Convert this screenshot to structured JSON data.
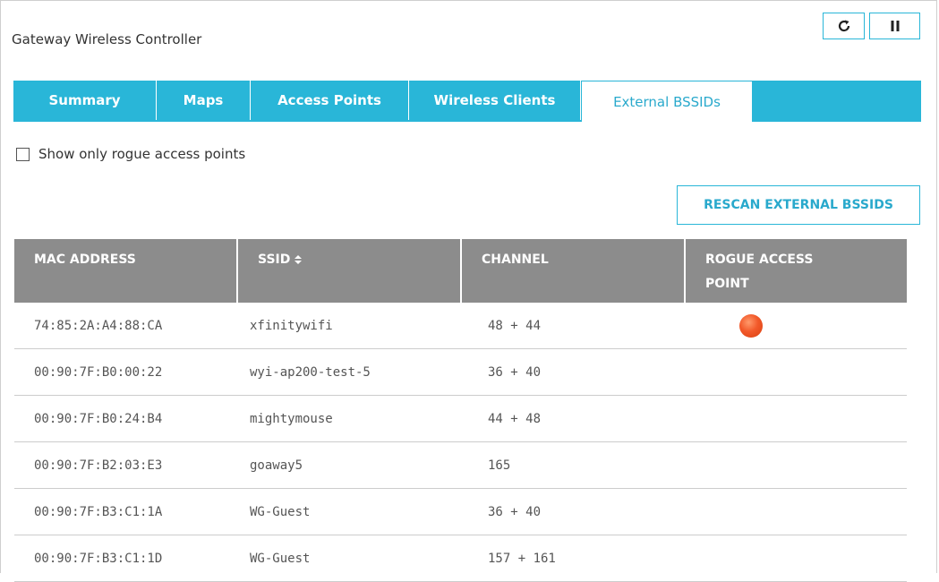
{
  "window": {
    "title": "Gateway Wireless Controller",
    "controls": [
      {
        "icon": "refresh-icon"
      },
      {
        "icon": "pause-icon"
      }
    ]
  },
  "tabs": [
    {
      "label": "Summary",
      "active": false
    },
    {
      "label": "Maps",
      "active": false
    },
    {
      "label": "Access Points",
      "active": false
    },
    {
      "label": "Wireless Clients",
      "active": false
    },
    {
      "label": "External BSSIDs",
      "active": true
    }
  ],
  "filter": {
    "label": "Show only rogue access points",
    "checked": false
  },
  "actions": {
    "rescan_label": "RESCAN EXTERNAL BSSIDS"
  },
  "table": {
    "columns": [
      "MAC ADDRESS",
      "SSID",
      "CHANNEL",
      "ROGUE ACCESS POINT"
    ],
    "rogue_col_line1": "ROGUE ACCESS",
    "rogue_col_line2": "POINT",
    "rows": [
      {
        "mac": "74:85:2A:A4:88:CA",
        "ssid": "xfinitywifi",
        "channel": "48 + 44",
        "rogue": true
      },
      {
        "mac": "00:90:7F:B0:00:22",
        "ssid": "wyi-ap200-test-5",
        "channel": "36 + 40",
        "rogue": false
      },
      {
        "mac": "00:90:7F:B0:24:B4",
        "ssid": "mightymouse",
        "channel": "44 + 48",
        "rogue": false
      },
      {
        "mac": "00:90:7F:B2:03:E3",
        "ssid": "goaway5",
        "channel": "165",
        "rogue": false
      },
      {
        "mac": "00:90:7F:B3:C1:1A",
        "ssid": "WG-Guest",
        "channel": "36 + 40",
        "rogue": false
      },
      {
        "mac": "00:90:7F:B3:C1:1D",
        "ssid": "WG-Guest",
        "channel": "157 + 161",
        "rogue": false
      }
    ]
  },
  "colors": {
    "accent": "#29b6d8",
    "header_bg": "#8c8c8c",
    "rogue_indicator": "#f2592a"
  }
}
